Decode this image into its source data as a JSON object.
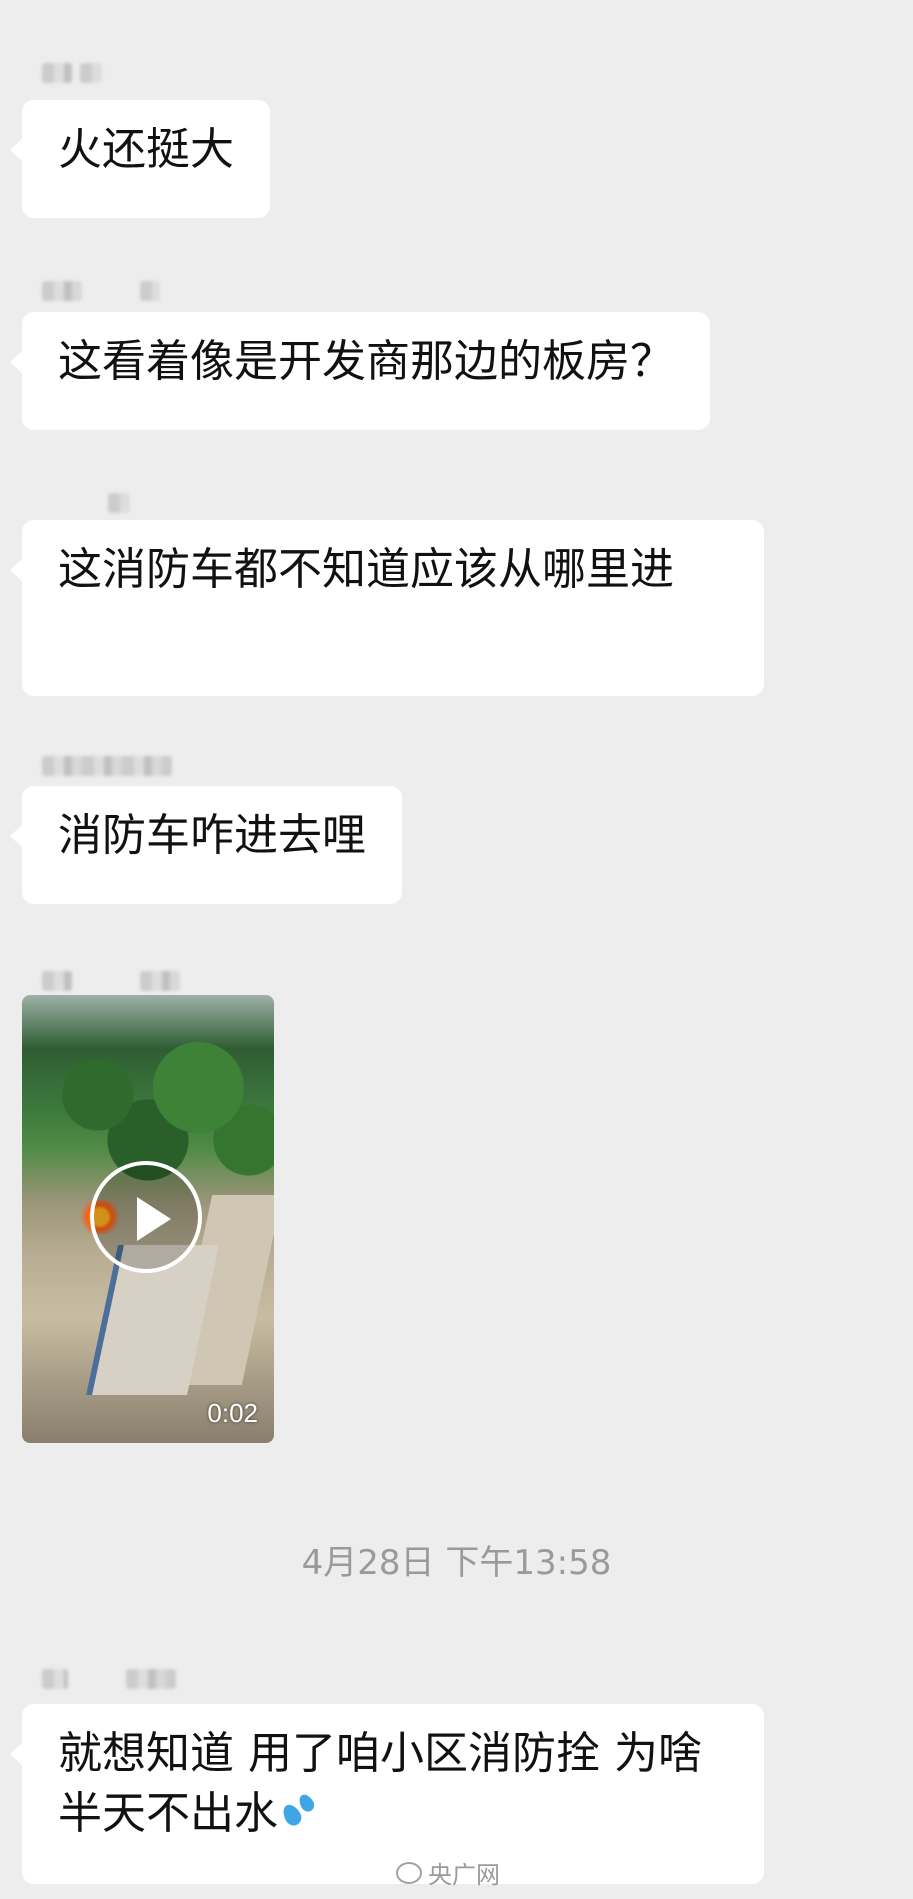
{
  "messages": [
    {
      "text": "火还挺大"
    },
    {
      "text": "这看着像是开发商那边的板房？"
    },
    {
      "text": "这消防车都不知道应该从哪里进"
    },
    {
      "text": "消防车咋进去哩"
    },
    {
      "video_duration": "0:02"
    },
    {
      "text": "就想知道 用了咱小区消防拴 为啥半天不出水",
      "emoji": "sweat-droplets-icon"
    }
  ],
  "timestamp": "4月28日 下午13:58",
  "watermark": "央广网",
  "colors": {
    "background": "#ededed",
    "bubble": "#ffffff",
    "timestamp": "#9a9a9a"
  }
}
